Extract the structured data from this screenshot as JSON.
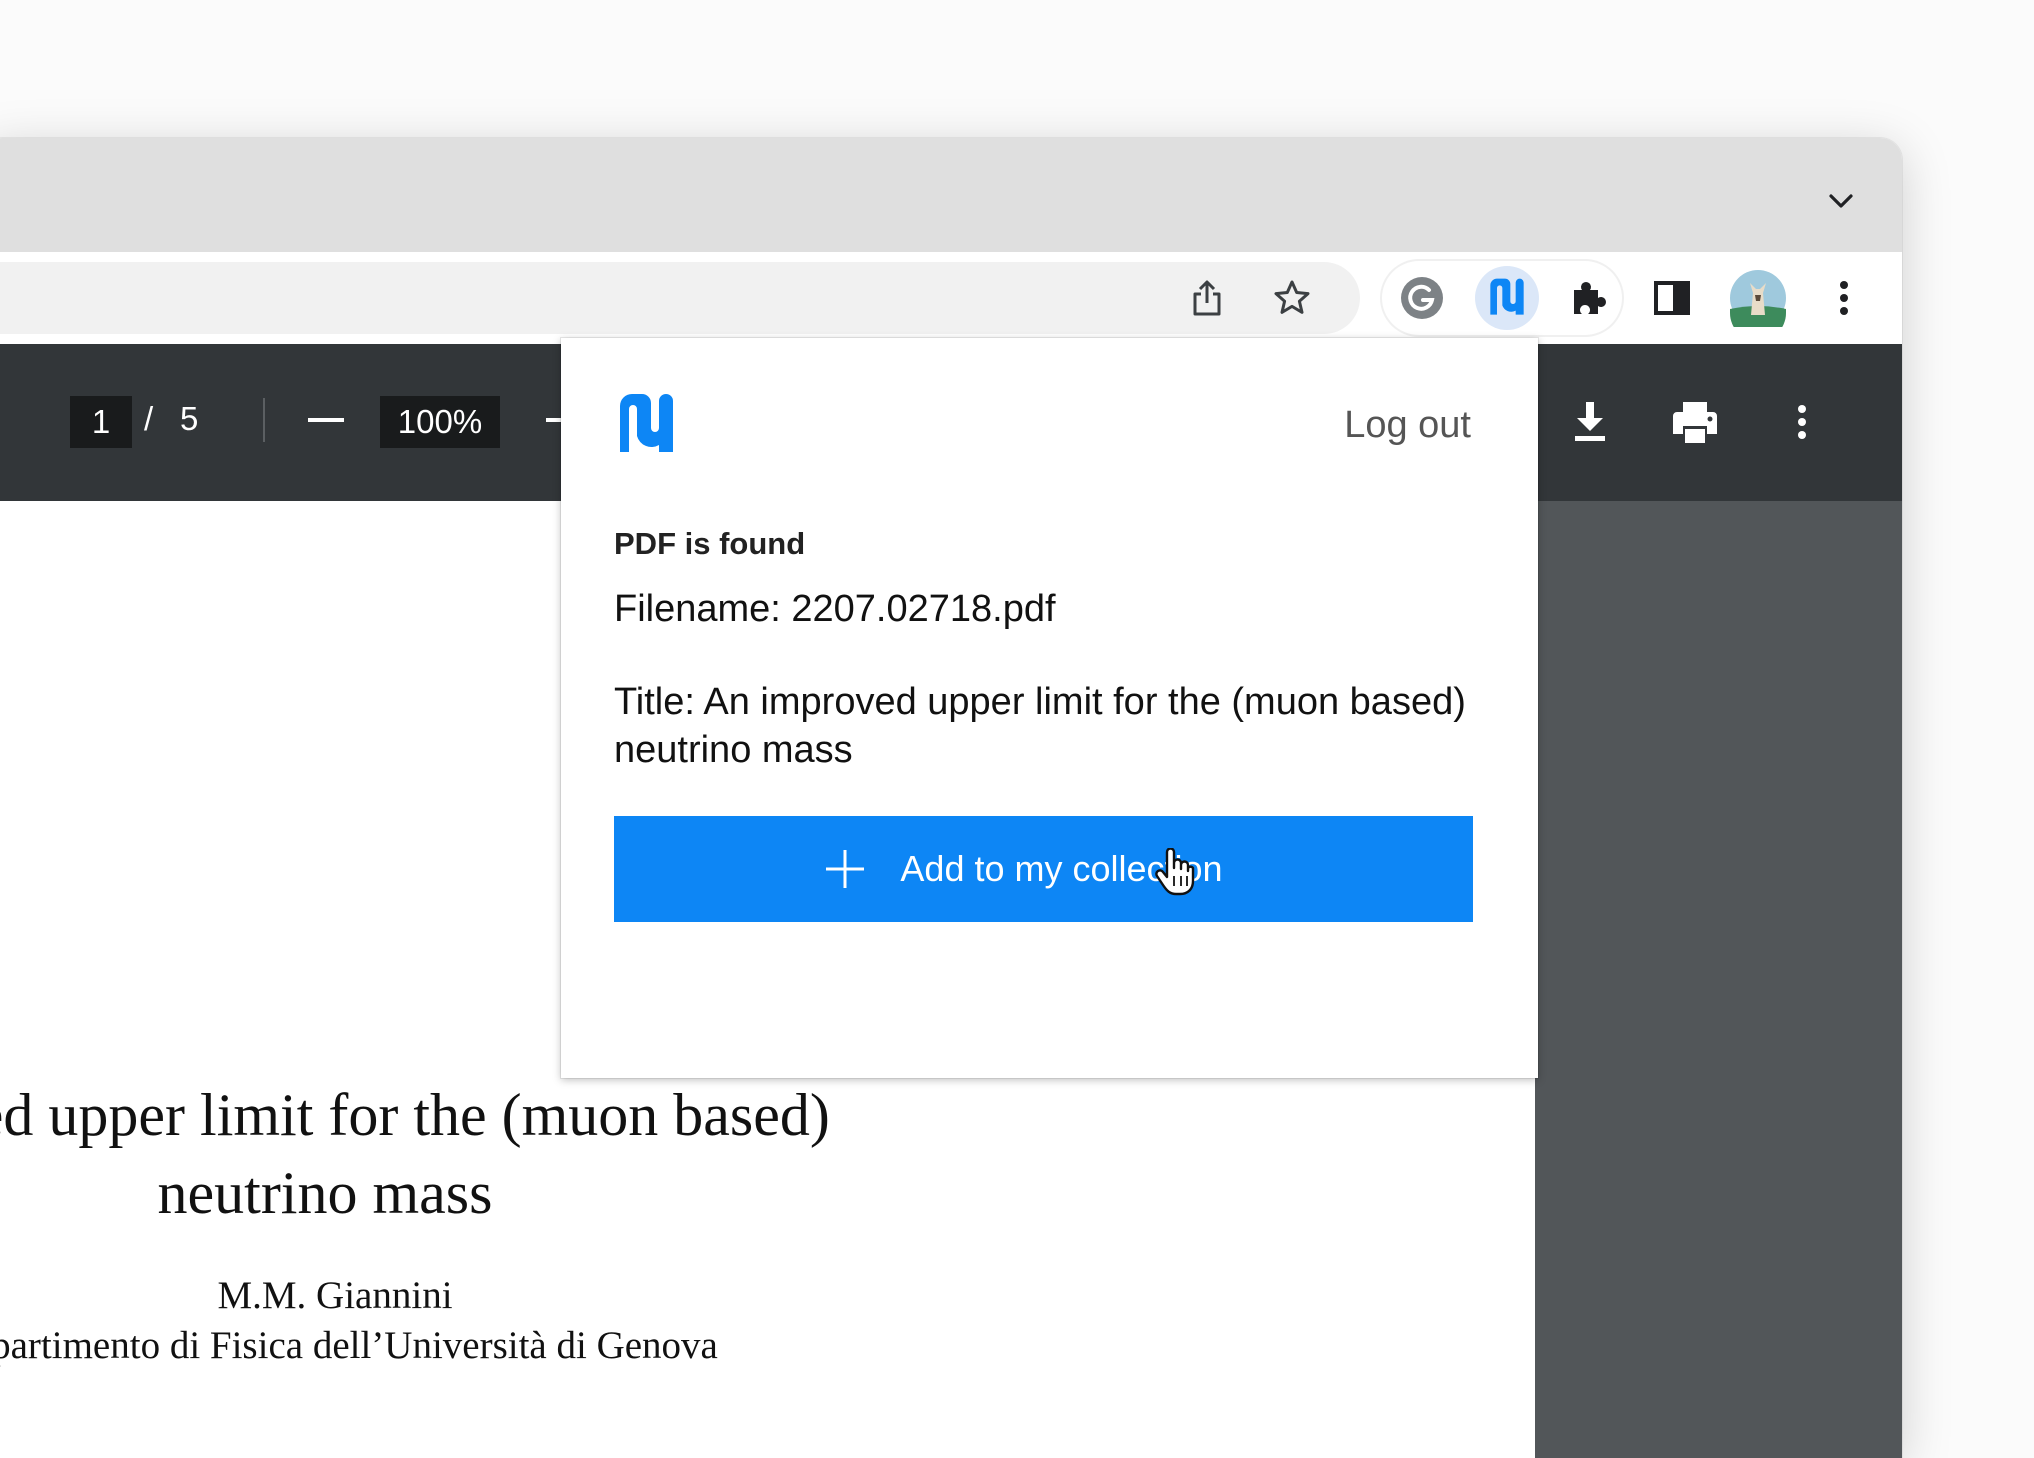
{
  "pdf_viewer": {
    "current_page": "1",
    "page_separator": "/",
    "total_pages": "5",
    "zoom_level": "100%"
  },
  "pdf_document": {
    "title_line_1": "mproved upper limit for the (muon based)",
    "title_line_2": "neutrino mass",
    "author": "M.M. Giannini",
    "affiliation": "Dipartimento di Fisica dell’Università di Genova"
  },
  "extension_popup": {
    "logout_label": "Log out",
    "status_heading": "PDF is found",
    "filename_text": "Filename: 2207.02718.pdf",
    "title_text": "Title: An improved upper limit for the (muon based) neutrino mass",
    "add_button_label": "Add to my collection"
  },
  "colors": {
    "accent_blue": "#0d86f5",
    "pdf_toolbar": "#323639",
    "pdf_background": "#525659",
    "tab_strip": "#dfdfdf"
  },
  "icons": {
    "tab_strip": [
      "chevron-down-icon"
    ],
    "toolbar": [
      "share-icon",
      "star-icon",
      "grammarly-icon",
      "extension-logo-icon",
      "puzzle-icon",
      "side-panel-icon",
      "avatar",
      "kebab-menu-icon"
    ],
    "pdf_toolbar": [
      "minus-icon",
      "plus-icon",
      "download-icon",
      "print-icon",
      "kebab-menu-icon"
    ],
    "popup": [
      "extension-logo-icon",
      "plus-icon"
    ],
    "pointer": "hand-cursor-icon"
  }
}
